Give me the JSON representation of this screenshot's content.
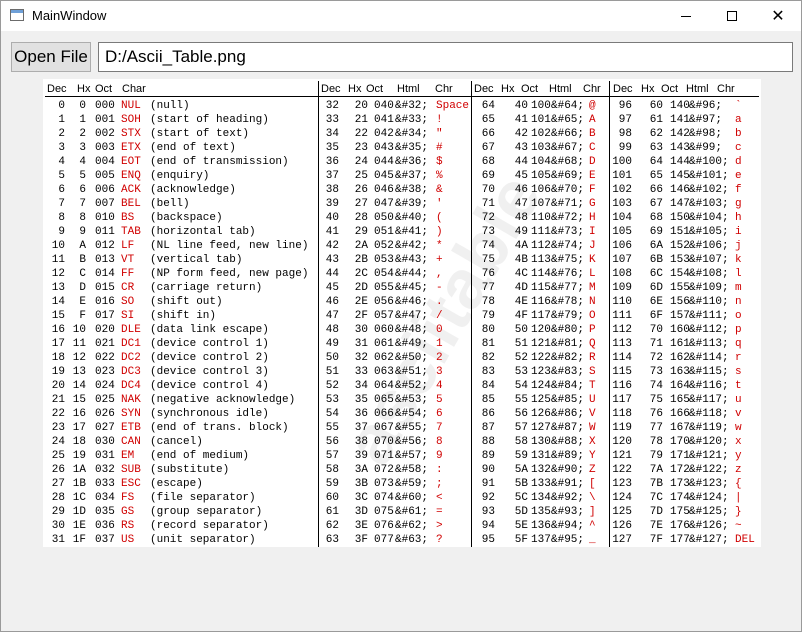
{
  "window": {
    "title": "MainWindow"
  },
  "toolbar": {
    "open_file_label": "Open File",
    "path_value": "D:/Ascii_Table.png"
  },
  "headers": {
    "dec": "Dec",
    "hx": "Hx",
    "oct": "Oct",
    "char": "Char",
    "html": "Html",
    "chr": "Chr"
  },
  "control_rows": [
    [
      "0",
      "0",
      "000",
      "NUL",
      "(null)"
    ],
    [
      "1",
      "1",
      "001",
      "SOH",
      "(start of heading)"
    ],
    [
      "2",
      "2",
      "002",
      "STX",
      "(start of text)"
    ],
    [
      "3",
      "3",
      "003",
      "ETX",
      "(end of text)"
    ],
    [
      "4",
      "4",
      "004",
      "EOT",
      "(end of transmission)"
    ],
    [
      "5",
      "5",
      "005",
      "ENQ",
      "(enquiry)"
    ],
    [
      "6",
      "6",
      "006",
      "ACK",
      "(acknowledge)"
    ],
    [
      "7",
      "7",
      "007",
      "BEL",
      "(bell)"
    ],
    [
      "8",
      "8",
      "010",
      "BS",
      "(backspace)"
    ],
    [
      "9",
      "9",
      "011",
      "TAB",
      "(horizontal tab)"
    ],
    [
      "10",
      "A",
      "012",
      "LF",
      "(NL line feed, new line)"
    ],
    [
      "11",
      "B",
      "013",
      "VT",
      "(vertical tab)"
    ],
    [
      "12",
      "C",
      "014",
      "FF",
      "(NP form feed, new page)"
    ],
    [
      "13",
      "D",
      "015",
      "CR",
      "(carriage return)"
    ],
    [
      "14",
      "E",
      "016",
      "SO",
      "(shift out)"
    ],
    [
      "15",
      "F",
      "017",
      "SI",
      "(shift in)"
    ],
    [
      "16",
      "10",
      "020",
      "DLE",
      "(data link escape)"
    ],
    [
      "17",
      "11",
      "021",
      "DC1",
      "(device control 1)"
    ],
    [
      "18",
      "12",
      "022",
      "DC2",
      "(device control 2)"
    ],
    [
      "19",
      "13",
      "023",
      "DC3",
      "(device control 3)"
    ],
    [
      "20",
      "14",
      "024",
      "DC4",
      "(device control 4)"
    ],
    [
      "21",
      "15",
      "025",
      "NAK",
      "(negative acknowledge)"
    ],
    [
      "22",
      "16",
      "026",
      "SYN",
      "(synchronous idle)"
    ],
    [
      "23",
      "17",
      "027",
      "ETB",
      "(end of trans. block)"
    ],
    [
      "24",
      "18",
      "030",
      "CAN",
      "(cancel)"
    ],
    [
      "25",
      "19",
      "031",
      "EM",
      "(end of medium)"
    ],
    [
      "26",
      "1A",
      "032",
      "SUB",
      "(substitute)"
    ],
    [
      "27",
      "1B",
      "033",
      "ESC",
      "(escape)"
    ],
    [
      "28",
      "1C",
      "034",
      "FS",
      "(file separator)"
    ],
    [
      "29",
      "1D",
      "035",
      "GS",
      "(group separator)"
    ],
    [
      "30",
      "1E",
      "036",
      "RS",
      "(record separator)"
    ],
    [
      "31",
      "1F",
      "037",
      "US",
      "(unit separator)"
    ]
  ],
  "col2_rows": [
    [
      "32",
      "20",
      "040",
      "&#32;",
      "Space"
    ],
    [
      "33",
      "21",
      "041",
      "&#33;",
      "!"
    ],
    [
      "34",
      "22",
      "042",
      "&#34;",
      "\""
    ],
    [
      "35",
      "23",
      "043",
      "&#35;",
      "#"
    ],
    [
      "36",
      "24",
      "044",
      "&#36;",
      "$"
    ],
    [
      "37",
      "25",
      "045",
      "&#37;",
      "%"
    ],
    [
      "38",
      "26",
      "046",
      "&#38;",
      "&"
    ],
    [
      "39",
      "27",
      "047",
      "&#39;",
      "'"
    ],
    [
      "40",
      "28",
      "050",
      "&#40;",
      "("
    ],
    [
      "41",
      "29",
      "051",
      "&#41;",
      ")"
    ],
    [
      "42",
      "2A",
      "052",
      "&#42;",
      "*"
    ],
    [
      "43",
      "2B",
      "053",
      "&#43;",
      "+"
    ],
    [
      "44",
      "2C",
      "054",
      "&#44;",
      ","
    ],
    [
      "45",
      "2D",
      "055",
      "&#45;",
      "-"
    ],
    [
      "46",
      "2E",
      "056",
      "&#46;",
      "."
    ],
    [
      "47",
      "2F",
      "057",
      "&#47;",
      "/"
    ],
    [
      "48",
      "30",
      "060",
      "&#48;",
      "0"
    ],
    [
      "49",
      "31",
      "061",
      "&#49;",
      "1"
    ],
    [
      "50",
      "32",
      "062",
      "&#50;",
      "2"
    ],
    [
      "51",
      "33",
      "063",
      "&#51;",
      "3"
    ],
    [
      "52",
      "34",
      "064",
      "&#52;",
      "4"
    ],
    [
      "53",
      "35",
      "065",
      "&#53;",
      "5"
    ],
    [
      "54",
      "36",
      "066",
      "&#54;",
      "6"
    ],
    [
      "55",
      "37",
      "067",
      "&#55;",
      "7"
    ],
    [
      "56",
      "38",
      "070",
      "&#56;",
      "8"
    ],
    [
      "57",
      "39",
      "071",
      "&#57;",
      "9"
    ],
    [
      "58",
      "3A",
      "072",
      "&#58;",
      ":"
    ],
    [
      "59",
      "3B",
      "073",
      "&#59;",
      ";"
    ],
    [
      "60",
      "3C",
      "074",
      "&#60;",
      "<"
    ],
    [
      "61",
      "3D",
      "075",
      "&#61;",
      "="
    ],
    [
      "62",
      "3E",
      "076",
      "&#62;",
      ">"
    ],
    [
      "63",
      "3F",
      "077",
      "&#63;",
      "?"
    ]
  ],
  "col3_rows": [
    [
      "64",
      "40",
      "100",
      "&#64;",
      "@"
    ],
    [
      "65",
      "41",
      "101",
      "&#65;",
      "A"
    ],
    [
      "66",
      "42",
      "102",
      "&#66;",
      "B"
    ],
    [
      "67",
      "43",
      "103",
      "&#67;",
      "C"
    ],
    [
      "68",
      "44",
      "104",
      "&#68;",
      "D"
    ],
    [
      "69",
      "45",
      "105",
      "&#69;",
      "E"
    ],
    [
      "70",
      "46",
      "106",
      "&#70;",
      "F"
    ],
    [
      "71",
      "47",
      "107",
      "&#71;",
      "G"
    ],
    [
      "72",
      "48",
      "110",
      "&#72;",
      "H"
    ],
    [
      "73",
      "49",
      "111",
      "&#73;",
      "I"
    ],
    [
      "74",
      "4A",
      "112",
      "&#74;",
      "J"
    ],
    [
      "75",
      "4B",
      "113",
      "&#75;",
      "K"
    ],
    [
      "76",
      "4C",
      "114",
      "&#76;",
      "L"
    ],
    [
      "77",
      "4D",
      "115",
      "&#77;",
      "M"
    ],
    [
      "78",
      "4E",
      "116",
      "&#78;",
      "N"
    ],
    [
      "79",
      "4F",
      "117",
      "&#79;",
      "O"
    ],
    [
      "80",
      "50",
      "120",
      "&#80;",
      "P"
    ],
    [
      "81",
      "51",
      "121",
      "&#81;",
      "Q"
    ],
    [
      "82",
      "52",
      "122",
      "&#82;",
      "R"
    ],
    [
      "83",
      "53",
      "123",
      "&#83;",
      "S"
    ],
    [
      "84",
      "54",
      "124",
      "&#84;",
      "T"
    ],
    [
      "85",
      "55",
      "125",
      "&#85;",
      "U"
    ],
    [
      "86",
      "56",
      "126",
      "&#86;",
      "V"
    ],
    [
      "87",
      "57",
      "127",
      "&#87;",
      "W"
    ],
    [
      "88",
      "58",
      "130",
      "&#88;",
      "X"
    ],
    [
      "89",
      "59",
      "131",
      "&#89;",
      "Y"
    ],
    [
      "90",
      "5A",
      "132",
      "&#90;",
      "Z"
    ],
    [
      "91",
      "5B",
      "133",
      "&#91;",
      "["
    ],
    [
      "92",
      "5C",
      "134",
      "&#92;",
      "\\"
    ],
    [
      "93",
      "5D",
      "135",
      "&#93;",
      "]"
    ],
    [
      "94",
      "5E",
      "136",
      "&#94;",
      "^"
    ],
    [
      "95",
      "5F",
      "137",
      "&#95;",
      "_"
    ]
  ],
  "col4_rows": [
    [
      "96",
      "60",
      "140",
      "&#96;",
      "`"
    ],
    [
      "97",
      "61",
      "141",
      "&#97;",
      "a"
    ],
    [
      "98",
      "62",
      "142",
      "&#98;",
      "b"
    ],
    [
      "99",
      "63",
      "143",
      "&#99;",
      "c"
    ],
    [
      "100",
      "64",
      "144",
      "&#100;",
      "d"
    ],
    [
      "101",
      "65",
      "145",
      "&#101;",
      "e"
    ],
    [
      "102",
      "66",
      "146",
      "&#102;",
      "f"
    ],
    [
      "103",
      "67",
      "147",
      "&#103;",
      "g"
    ],
    [
      "104",
      "68",
      "150",
      "&#104;",
      "h"
    ],
    [
      "105",
      "69",
      "151",
      "&#105;",
      "i"
    ],
    [
      "106",
      "6A",
      "152",
      "&#106;",
      "j"
    ],
    [
      "107",
      "6B",
      "153",
      "&#107;",
      "k"
    ],
    [
      "108",
      "6C",
      "154",
      "&#108;",
      "l"
    ],
    [
      "109",
      "6D",
      "155",
      "&#109;",
      "m"
    ],
    [
      "110",
      "6E",
      "156",
      "&#110;",
      "n"
    ],
    [
      "111",
      "6F",
      "157",
      "&#111;",
      "o"
    ],
    [
      "112",
      "70",
      "160",
      "&#112;",
      "p"
    ],
    [
      "113",
      "71",
      "161",
      "&#113;",
      "q"
    ],
    [
      "114",
      "72",
      "162",
      "&#114;",
      "r"
    ],
    [
      "115",
      "73",
      "163",
      "&#115;",
      "s"
    ],
    [
      "116",
      "74",
      "164",
      "&#116;",
      "t"
    ],
    [
      "117",
      "75",
      "165",
      "&#117;",
      "u"
    ],
    [
      "118",
      "76",
      "166",
      "&#118;",
      "v"
    ],
    [
      "119",
      "77",
      "167",
      "&#119;",
      "w"
    ],
    [
      "120",
      "78",
      "170",
      "&#120;",
      "x"
    ],
    [
      "121",
      "79",
      "171",
      "&#121;",
      "y"
    ],
    [
      "122",
      "7A",
      "172",
      "&#122;",
      "z"
    ],
    [
      "123",
      "7B",
      "173",
      "&#123;",
      "{"
    ],
    [
      "124",
      "7C",
      "174",
      "&#124;",
      "|"
    ],
    [
      "125",
      "7D",
      "175",
      "&#125;",
      "}"
    ],
    [
      "126",
      "7E",
      "176",
      "&#126;",
      "~"
    ],
    [
      "127",
      "7F",
      "177",
      "&#127;",
      "DEL"
    ]
  ],
  "colors": {
    "char_red": "#d00000"
  }
}
